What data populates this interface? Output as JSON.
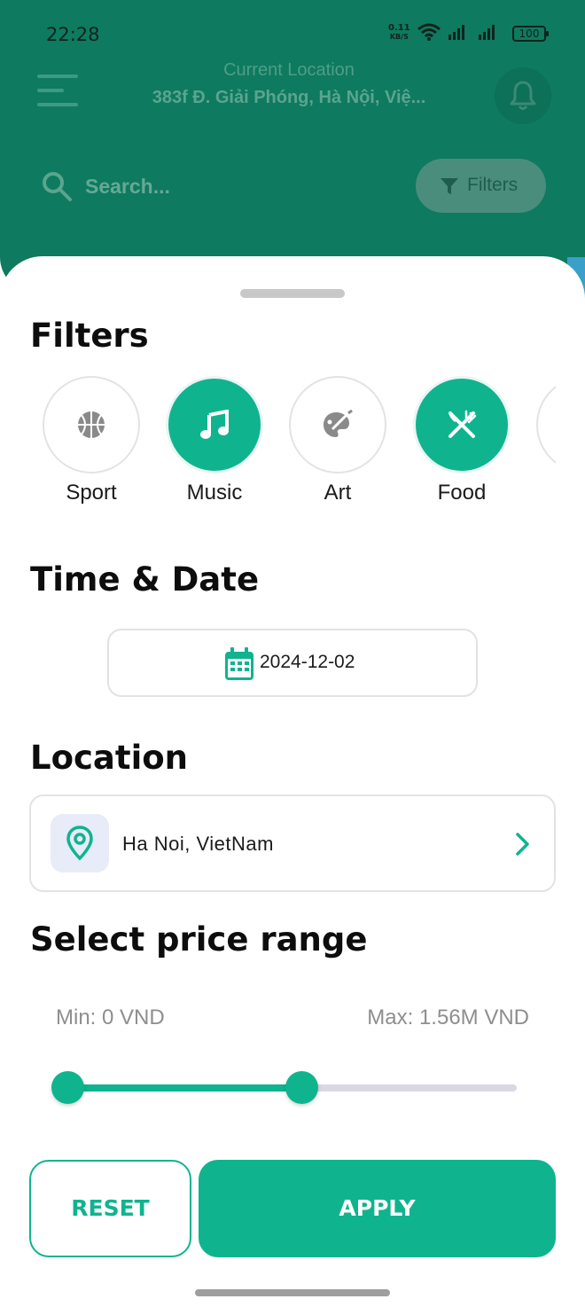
{
  "status_bar": {
    "time": "22:28",
    "net_speed": "0.11",
    "net_unit": "KB/S",
    "battery": "100"
  },
  "header": {
    "location_label": "Current Location",
    "location_value": "383f Đ. Giải Phóng, Hà Nội, Việ...",
    "search_placeholder": "Search...",
    "filters_label": "Filters"
  },
  "filters": {
    "title": "Filters",
    "categories": [
      {
        "label": "Sport",
        "icon": "basketball-icon",
        "active": false
      },
      {
        "label": "Music",
        "icon": "music-note-icon",
        "active": true
      },
      {
        "label": "Art",
        "icon": "palette-icon",
        "active": false
      },
      {
        "label": "Food",
        "icon": "fork-knife-icon",
        "active": true
      },
      {
        "label": "",
        "icon": "more-category-icon",
        "active": false
      }
    ]
  },
  "time_date": {
    "title": "Time & Date",
    "date": "2024-12-02"
  },
  "location": {
    "title": "Location",
    "value": "Ha Noi, VietNam"
  },
  "price": {
    "title": "Select price range",
    "min_label": "Min: 0 VND",
    "max_label": "Max: 1.56M VND",
    "range_low": 0,
    "range_high": 0.52
  },
  "actions": {
    "reset": "RESET",
    "apply": "APPLY"
  },
  "colors": {
    "header_bg": "#0e7a5f",
    "accent": "#0fb48f",
    "track": "#d9d9e4"
  }
}
